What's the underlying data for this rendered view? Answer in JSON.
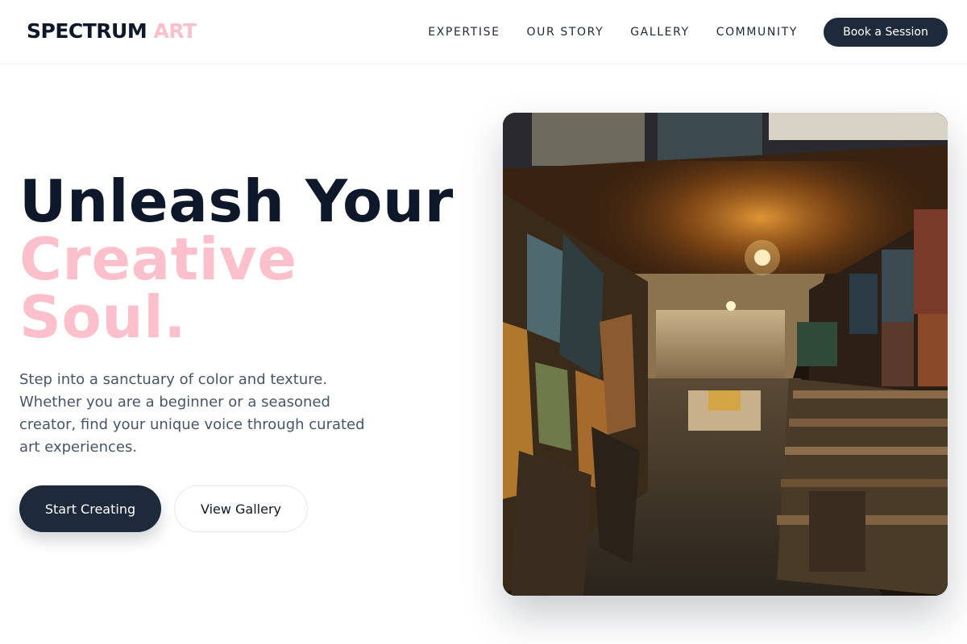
{
  "brand": {
    "name_part1": "SPECTRUM",
    "name_part2": "ART",
    "accent_color": "#fbc0cb",
    "dark_color": "#1e293b"
  },
  "nav": {
    "items": [
      {
        "label": "EXPERTISE"
      },
      {
        "label": "OUR STORY"
      },
      {
        "label": "GALLERY"
      },
      {
        "label": "COMMUNITY"
      }
    ],
    "cta_label": "Book a Session"
  },
  "hero": {
    "headline_line1": "Unleash Your",
    "headline_line2": "Creative",
    "headline_line3": "Soul.",
    "description": "Step into a sanctuary of color and texture. Whether you are a beginner or a seasoned creator, find your unique voice through curated art experiences.",
    "primary_button": "Start Creating",
    "secondary_button": "View Gallery",
    "image_subject": "art-gallery-corridor-photo"
  }
}
